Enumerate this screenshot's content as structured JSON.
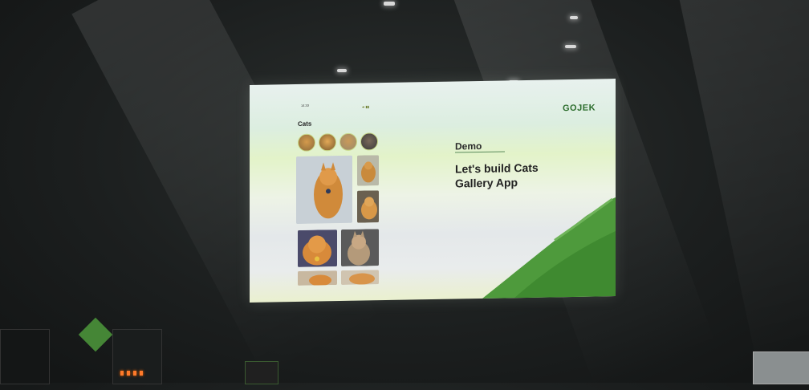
{
  "slide": {
    "title": "Demo",
    "subtitle": "Let's build Cats\nGallery App",
    "logo": "GOJEK",
    "colors": {
      "brand_green": "#2d6e2d",
      "brush_green": "#4e9a3c"
    }
  },
  "phone_mockup": {
    "status_time": "14:33",
    "status_icons": "◂▪ ▮▮",
    "heading": "Cats"
  }
}
